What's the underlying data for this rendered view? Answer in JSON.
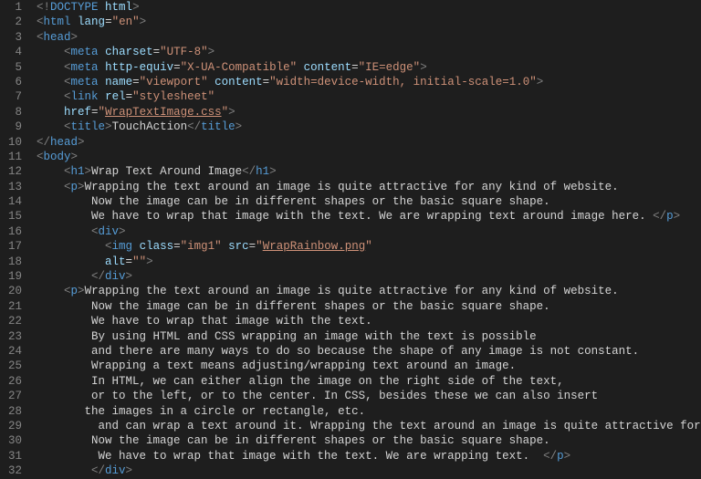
{
  "file_kind": "html-source",
  "lines": [
    {
      "n": 1,
      "indent": 0,
      "tokens": [
        {
          "t": "<!",
          "c": "p-doc"
        },
        {
          "t": "DOCTYPE",
          "c": "p-tag"
        },
        {
          "t": " ",
          "c": "p-doc"
        },
        {
          "t": "html",
          "c": "p-attr"
        },
        {
          "t": ">",
          "c": "p-doc"
        }
      ]
    },
    {
      "n": 2,
      "indent": 0,
      "tokens": [
        {
          "t": "<",
          "c": "p-ang"
        },
        {
          "t": "html",
          "c": "p-tag"
        },
        {
          "t": " ",
          "c": ""
        },
        {
          "t": "lang",
          "c": "p-attr"
        },
        {
          "t": "=",
          "c": "p-eq"
        },
        {
          "t": "\"en\"",
          "c": "p-str"
        },
        {
          "t": ">",
          "c": "p-ang"
        }
      ]
    },
    {
      "n": 3,
      "indent": 0,
      "tokens": [
        {
          "t": "<",
          "c": "p-ang"
        },
        {
          "t": "head",
          "c": "p-tag"
        },
        {
          "t": ">",
          "c": "p-ang"
        }
      ]
    },
    {
      "n": 4,
      "indent": 1,
      "tokens": [
        {
          "t": "<",
          "c": "p-ang"
        },
        {
          "t": "meta",
          "c": "p-tag"
        },
        {
          "t": " ",
          "c": ""
        },
        {
          "t": "charset",
          "c": "p-attr"
        },
        {
          "t": "=",
          "c": "p-eq"
        },
        {
          "t": "\"UTF-8\"",
          "c": "p-str"
        },
        {
          "t": ">",
          "c": "p-ang"
        }
      ]
    },
    {
      "n": 5,
      "indent": 1,
      "tokens": [
        {
          "t": "<",
          "c": "p-ang"
        },
        {
          "t": "meta",
          "c": "p-tag"
        },
        {
          "t": " ",
          "c": ""
        },
        {
          "t": "http-equiv",
          "c": "p-attr"
        },
        {
          "t": "=",
          "c": "p-eq"
        },
        {
          "t": "\"X-UA-Compatible\"",
          "c": "p-str"
        },
        {
          "t": " ",
          "c": ""
        },
        {
          "t": "content",
          "c": "p-attr"
        },
        {
          "t": "=",
          "c": "p-eq"
        },
        {
          "t": "\"IE=edge\"",
          "c": "p-str"
        },
        {
          "t": ">",
          "c": "p-ang"
        }
      ]
    },
    {
      "n": 6,
      "indent": 1,
      "tokens": [
        {
          "t": "<",
          "c": "p-ang"
        },
        {
          "t": "meta",
          "c": "p-tag"
        },
        {
          "t": " ",
          "c": ""
        },
        {
          "t": "name",
          "c": "p-attr"
        },
        {
          "t": "=",
          "c": "p-eq"
        },
        {
          "t": "\"viewport\"",
          "c": "p-str"
        },
        {
          "t": " ",
          "c": ""
        },
        {
          "t": "content",
          "c": "p-attr"
        },
        {
          "t": "=",
          "c": "p-eq"
        },
        {
          "t": "\"width=device-width, initial-scale=1.0\"",
          "c": "p-str"
        },
        {
          "t": ">",
          "c": "p-ang"
        }
      ]
    },
    {
      "n": 7,
      "indent": 1,
      "tokens": [
        {
          "t": "<",
          "c": "p-ang"
        },
        {
          "t": "link",
          "c": "p-tag"
        },
        {
          "t": " ",
          "c": ""
        },
        {
          "t": "rel",
          "c": "p-attr"
        },
        {
          "t": "=",
          "c": "p-eq"
        },
        {
          "t": "\"stylesheet\"",
          "c": "p-str"
        }
      ]
    },
    {
      "n": 8,
      "indent": 1,
      "tokens": [
        {
          "t": "href",
          "c": "p-attr"
        },
        {
          "t": "=",
          "c": "p-eq"
        },
        {
          "t": "\"",
          "c": "p-str"
        },
        {
          "t": "WrapTextImage.css",
          "c": "p-str ul"
        },
        {
          "t": "\"",
          "c": "p-str"
        },
        {
          "t": ">",
          "c": "p-ang"
        }
      ]
    },
    {
      "n": 9,
      "indent": 1,
      "tokens": [
        {
          "t": "<",
          "c": "p-ang"
        },
        {
          "t": "title",
          "c": "p-tag"
        },
        {
          "t": ">",
          "c": "p-ang"
        },
        {
          "t": "TouchAction",
          "c": "p-txt"
        },
        {
          "t": "</",
          "c": "p-ang"
        },
        {
          "t": "title",
          "c": "p-tag"
        },
        {
          "t": ">",
          "c": "p-ang"
        }
      ]
    },
    {
      "n": 10,
      "indent": 0,
      "tokens": [
        {
          "t": "</",
          "c": "p-ang"
        },
        {
          "t": "head",
          "c": "p-tag"
        },
        {
          "t": ">",
          "c": "p-ang"
        }
      ]
    },
    {
      "n": 11,
      "indent": 0,
      "tokens": [
        {
          "t": "<",
          "c": "p-ang"
        },
        {
          "t": "body",
          "c": "p-tag"
        },
        {
          "t": ">",
          "c": "p-ang"
        }
      ]
    },
    {
      "n": 12,
      "indent": 1,
      "tokens": [
        {
          "t": "<",
          "c": "p-ang"
        },
        {
          "t": "h1",
          "c": "p-tag"
        },
        {
          "t": ">",
          "c": "p-ang"
        },
        {
          "t": "Wrap Text Around Image",
          "c": "p-txt"
        },
        {
          "t": "</",
          "c": "p-ang"
        },
        {
          "t": "h1",
          "c": "p-tag"
        },
        {
          "t": ">",
          "c": "p-ang"
        }
      ]
    },
    {
      "n": 13,
      "indent": 1,
      "tokens": [
        {
          "t": "<",
          "c": "p-ang"
        },
        {
          "t": "p",
          "c": "p-tag"
        },
        {
          "t": ">",
          "c": "p-ang"
        },
        {
          "t": "Wrapping the text around an image is quite attractive for any kind of website.",
          "c": "p-txt"
        }
      ]
    },
    {
      "n": 14,
      "indent": 2,
      "tokens": [
        {
          "t": "Now the image can be in different shapes or the basic square shape.",
          "c": "p-txt"
        }
      ]
    },
    {
      "n": 15,
      "indent": 2,
      "tokens": [
        {
          "t": "We have to wrap that image with the text. We are wrapping text around image here. ",
          "c": "p-txt"
        },
        {
          "t": "</",
          "c": "p-ang"
        },
        {
          "t": "p",
          "c": "p-tag"
        },
        {
          "t": ">",
          "c": "p-ang"
        }
      ]
    },
    {
      "n": 16,
      "indent": 2,
      "tokens": [
        {
          "t": "<",
          "c": "p-ang"
        },
        {
          "t": "div",
          "c": "p-tag"
        },
        {
          "t": ">",
          "c": "p-ang"
        }
      ]
    },
    {
      "n": 17,
      "indent": 2,
      "tokens": [
        {
          "t": "  ",
          "c": ""
        },
        {
          "t": "<",
          "c": "p-ang"
        },
        {
          "t": "img",
          "c": "p-tag"
        },
        {
          "t": " ",
          "c": ""
        },
        {
          "t": "class",
          "c": "p-attr"
        },
        {
          "t": "=",
          "c": "p-eq"
        },
        {
          "t": "\"img1\"",
          "c": "p-str"
        },
        {
          "t": " ",
          "c": ""
        },
        {
          "t": "src",
          "c": "p-attr"
        },
        {
          "t": "=",
          "c": "p-eq"
        },
        {
          "t": "\"",
          "c": "p-str"
        },
        {
          "t": "WrapRainbow.png",
          "c": "p-str ul"
        },
        {
          "t": "\"",
          "c": "p-str"
        }
      ]
    },
    {
      "n": 18,
      "indent": 2,
      "tokens": [
        {
          "t": "  ",
          "c": ""
        },
        {
          "t": "alt",
          "c": "p-attr"
        },
        {
          "t": "=",
          "c": "p-eq"
        },
        {
          "t": "\"\"",
          "c": "p-str"
        },
        {
          "t": ">",
          "c": "p-ang"
        }
      ]
    },
    {
      "n": 19,
      "indent": 2,
      "tokens": [
        {
          "t": "</",
          "c": "p-ang"
        },
        {
          "t": "div",
          "c": "p-tag"
        },
        {
          "t": ">",
          "c": "p-ang"
        }
      ]
    },
    {
      "n": 20,
      "indent": 1,
      "tokens": [
        {
          "t": "<",
          "c": "p-ang"
        },
        {
          "t": "p",
          "c": "p-tag"
        },
        {
          "t": ">",
          "c": "p-ang"
        },
        {
          "t": "Wrapping the text around an image is quite attractive for any kind of website.",
          "c": "p-txt"
        }
      ]
    },
    {
      "n": 21,
      "indent": 2,
      "tokens": [
        {
          "t": "Now the image can be in different shapes or the basic square shape.",
          "c": "p-txt"
        }
      ]
    },
    {
      "n": 22,
      "indent": 2,
      "tokens": [
        {
          "t": "We have to wrap that image with the text.",
          "c": "p-txt"
        }
      ]
    },
    {
      "n": 23,
      "indent": 2,
      "tokens": [
        {
          "t": "By using HTML and CSS wrapping an image with the text is possible",
          "c": "p-txt"
        }
      ]
    },
    {
      "n": 24,
      "indent": 2,
      "tokens": [
        {
          "t": "and there are many ways to do so because the shape of any image is not constant.",
          "c": "p-txt"
        }
      ]
    },
    {
      "n": 25,
      "indent": 2,
      "tokens": [
        {
          "t": "Wrapping a text means adjusting/wrapping text around an image.",
          "c": "p-txt"
        }
      ]
    },
    {
      "n": 26,
      "indent": 2,
      "tokens": [
        {
          "t": "In HTML, we can either align the image on the right side of the text,",
          "c": "p-txt"
        }
      ]
    },
    {
      "n": 27,
      "indent": 2,
      "tokens": [
        {
          "t": "or to the left, or to the center. In CSS, besides these we can also insert",
          "c": "p-txt"
        }
      ]
    },
    {
      "n": 28,
      "indent": 1,
      "tokens": [
        {
          "t": "   the images in a circle or rectangle, etc.",
          "c": "p-txt"
        }
      ]
    },
    {
      "n": 29,
      "indent": 2,
      "tokens": [
        {
          "t": " and can wrap a text around it. Wrapping the text around an image is quite attractive for any kind of",
          "c": "p-txt"
        }
      ]
    },
    {
      "n": 30,
      "indent": 2,
      "tokens": [
        {
          "t": "Now the image can be in different shapes or the basic square shape.",
          "c": "p-txt"
        }
      ]
    },
    {
      "n": 31,
      "indent": 2,
      "tokens": [
        {
          "t": " We have to wrap that image with the text. We are wrapping text.  ",
          "c": "p-txt"
        },
        {
          "t": "</",
          "c": "p-ang"
        },
        {
          "t": "p",
          "c": "p-tag"
        },
        {
          "t": ">",
          "c": "p-ang"
        }
      ]
    },
    {
      "n": 32,
      "indent": 2,
      "tokens": [
        {
          "t": "</",
          "c": "p-ang"
        },
        {
          "t": "div",
          "c": "p-tag"
        },
        {
          "t": ">",
          "c": "p-ang"
        }
      ]
    }
  ]
}
